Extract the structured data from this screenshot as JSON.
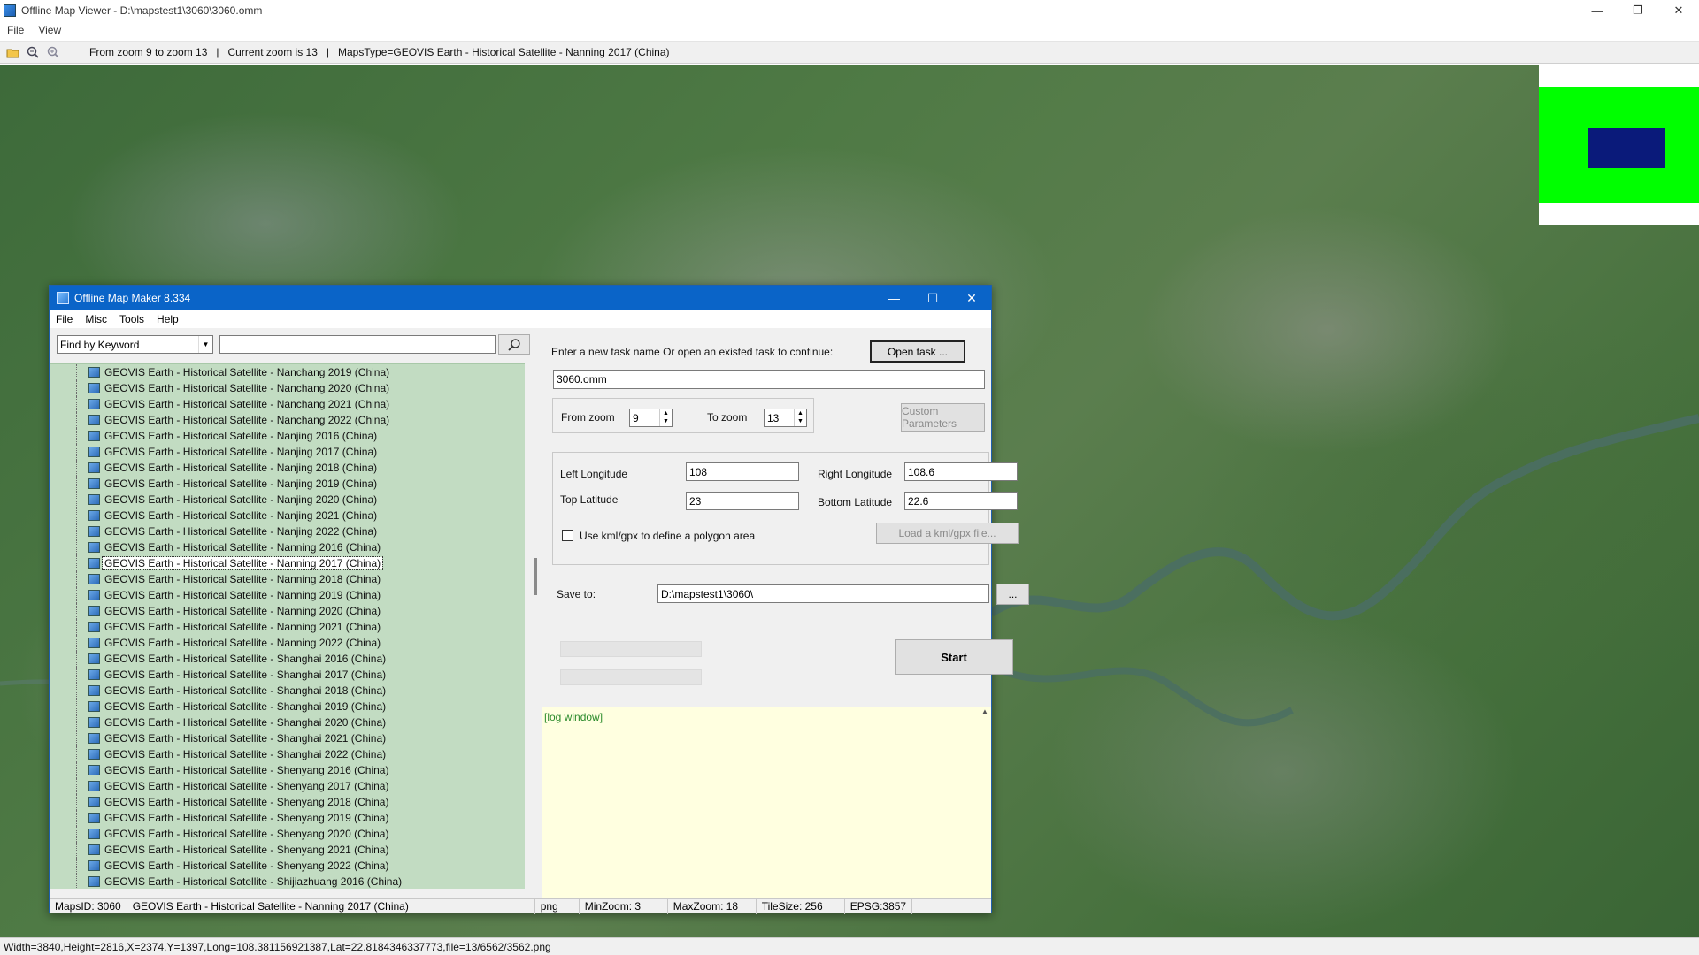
{
  "window": {
    "title": "Offline Map Viewer - D:\\mapstest1\\3060\\3060.omm",
    "buttons": {
      "minimize": "—",
      "restore": "❐",
      "close": "✕"
    }
  },
  "menu": [
    "File",
    "View"
  ],
  "toolbar": {
    "icons": [
      "open-folder-icon",
      "zoom-out-icon",
      "zoom-in-icon"
    ],
    "zoom_range": "From zoom 9 to zoom 13",
    "current_zoom": "Current zoom is 13",
    "maps_type": "MapsType=GEOVIS Earth - Historical Satellite - Nanning 2017 (China)"
  },
  "statusbar": {
    "text": "Width=3840,Height=2816,X=2374,Y=1397,Long=108.381156921387,Lat=22.8184346337773,file=13/6562/3562.png"
  },
  "dialog": {
    "title": "Offline Map Maker 8.334",
    "menu": [
      "File",
      "Misc",
      "Tools",
      "Help"
    ],
    "find_by": "Find by Keyword",
    "search_value": "",
    "map_list": [
      "GEOVIS Earth - Historical Satellite - Nanchang 2019 (China)",
      "GEOVIS Earth - Historical Satellite - Nanchang 2020 (China)",
      "GEOVIS Earth - Historical Satellite - Nanchang 2021 (China)",
      "GEOVIS Earth - Historical Satellite - Nanchang 2022 (China)",
      "GEOVIS Earth - Historical Satellite - Nanjing 2016 (China)",
      "GEOVIS Earth - Historical Satellite - Nanjing 2017 (China)",
      "GEOVIS Earth - Historical Satellite - Nanjing 2018 (China)",
      "GEOVIS Earth - Historical Satellite - Nanjing 2019 (China)",
      "GEOVIS Earth - Historical Satellite - Nanjing 2020 (China)",
      "GEOVIS Earth - Historical Satellite - Nanjing 2021 (China)",
      "GEOVIS Earth - Historical Satellite - Nanjing 2022 (China)",
      "GEOVIS Earth - Historical Satellite - Nanning 2016 (China)",
      "GEOVIS Earth - Historical Satellite - Nanning 2017 (China)",
      "GEOVIS Earth - Historical Satellite - Nanning 2018 (China)",
      "GEOVIS Earth - Historical Satellite - Nanning 2019 (China)",
      "GEOVIS Earth - Historical Satellite - Nanning 2020 (China)",
      "GEOVIS Earth - Historical Satellite - Nanning 2021 (China)",
      "GEOVIS Earth - Historical Satellite - Nanning 2022 (China)",
      "GEOVIS Earth - Historical Satellite - Shanghai 2016 (China)",
      "GEOVIS Earth - Historical Satellite - Shanghai 2017 (China)",
      "GEOVIS Earth - Historical Satellite - Shanghai 2018 (China)",
      "GEOVIS Earth - Historical Satellite - Shanghai 2019 (China)",
      "GEOVIS Earth - Historical Satellite - Shanghai 2020 (China)",
      "GEOVIS Earth - Historical Satellite - Shanghai 2021 (China)",
      "GEOVIS Earth - Historical Satellite - Shanghai 2022 (China)",
      "GEOVIS Earth - Historical Satellite - Shenyang 2016 (China)",
      "GEOVIS Earth - Historical Satellite - Shenyang 2017 (China)",
      "GEOVIS Earth - Historical Satellite - Shenyang 2018 (China)",
      "GEOVIS Earth - Historical Satellite - Shenyang 2019 (China)",
      "GEOVIS Earth - Historical Satellite - Shenyang 2020 (China)",
      "GEOVIS Earth - Historical Satellite - Shenyang 2021 (China)",
      "GEOVIS Earth - Historical Satellite - Shenyang 2022 (China)",
      "GEOVIS Earth - Historical Satellite - Shijiazhuang 2016 (China)"
    ],
    "selected_index": 12,
    "task_prompt": "Enter a new task name Or open an existed task to continue:",
    "open_task_label": "Open task ...",
    "task_name": "3060.omm",
    "from_zoom_label": "From zoom",
    "from_zoom": "9",
    "to_zoom_label": "To zoom",
    "to_zoom": "13",
    "custom_params_label": "Custom Parameters",
    "left_lon_label": "Left Longitude",
    "left_lon": "108",
    "right_lon_label": "Right Longitude",
    "right_lon": "108.6",
    "top_lat_label": "Top Latitude",
    "top_lat": "23",
    "bottom_lat_label": "Bottom Latitude",
    "bottom_lat": "22.6",
    "kml_label": "Use kml/gpx to define a polygon area",
    "kml_checked": false,
    "load_kml_label": "Load a kml/gpx file...",
    "save_to_label": "Save to:",
    "save_to": "D:\\mapstest1\\3060\\",
    "browse_label": "...",
    "start_label": "Start",
    "log_text": "[log window]",
    "status": {
      "maps_id": "MapsID: 3060",
      "map_name": "GEOVIS Earth - Historical Satellite - Nanning 2017 (China)",
      "format": "png",
      "min_zoom": "MinZoom: 3",
      "max_zoom": "MaxZoom: 18",
      "tile_size": "TileSize: 256",
      "epsg": "EPSG:3857"
    }
  },
  "colors": {
    "dialog_title_bg": "#0a64c8",
    "list_bg": "#c2dcc2",
    "log_bg": "#ffffe0",
    "overview_green": "#00ff00",
    "overview_viewport": "#0a1a7a"
  }
}
